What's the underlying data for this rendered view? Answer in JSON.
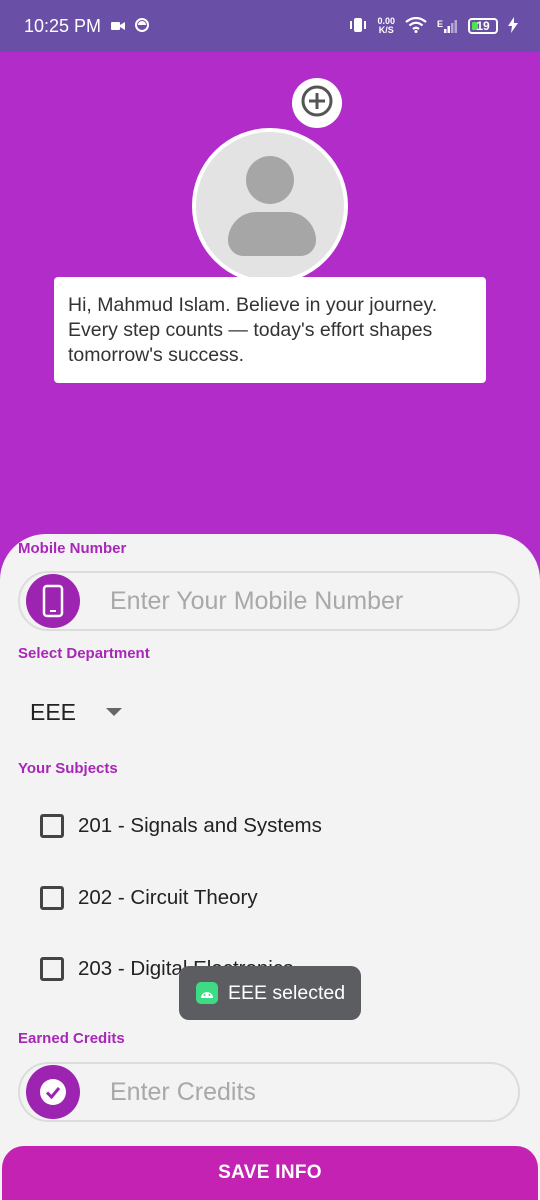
{
  "status_bar": {
    "time": "10:25 PM",
    "net_speed_value": "0.00",
    "net_speed_unit": "K/S",
    "signal_type": "E",
    "battery": "19"
  },
  "greeting": {
    "text": "Hi, Mahmud Islam. Believe in your journey. Every step counts — today's effort shapes tomorrow's success."
  },
  "mobile": {
    "label": "Mobile Number",
    "placeholder": "Enter Your Mobile Number",
    "value": ""
  },
  "department": {
    "label": "Select Department",
    "selected": "EEE"
  },
  "subjects": {
    "label": "Your Subjects",
    "items": [
      {
        "label": "201 - Signals and Systems",
        "checked": false
      },
      {
        "label": "202 - Circuit Theory",
        "checked": false
      },
      {
        "label": "203 - Digital Electronics",
        "checked": false
      }
    ]
  },
  "credits": {
    "label": "Earned Credits",
    "placeholder": "Enter Credits",
    "value": ""
  },
  "toast": {
    "text": "EEE selected"
  },
  "save_button": {
    "label": "SAVE INFO"
  },
  "colors": {
    "header_bg": "#b12cc9",
    "status_bar_bg": "#6a4fa6",
    "accent": "#a827b8",
    "button_bg": "#c322b3"
  }
}
